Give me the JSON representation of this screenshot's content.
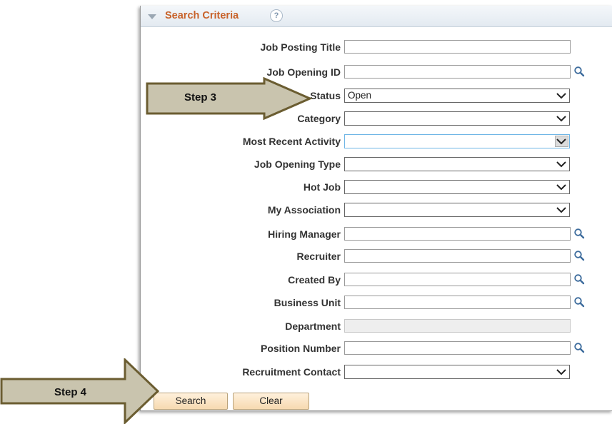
{
  "panel": {
    "title": "Search Criteria",
    "help_glyph": "?"
  },
  "fields": [
    {
      "label": "Job Posting Title",
      "kind": "input"
    },
    {
      "label": "Job Opening ID",
      "kind": "lookup"
    },
    {
      "label": "Status",
      "kind": "select",
      "value": "Open"
    },
    {
      "label": "Category",
      "kind": "select",
      "value": ""
    },
    {
      "label": "Most Recent Activity",
      "kind": "select",
      "value": ""
    },
    {
      "label": "Job Opening Type",
      "kind": "select",
      "value": ""
    },
    {
      "label": "Hot Job",
      "kind": "select",
      "value": ""
    },
    {
      "label": "My Association",
      "kind": "select",
      "value": ""
    },
    {
      "label": "Hiring Manager",
      "kind": "lookup"
    },
    {
      "label": "Recruiter",
      "kind": "lookup"
    },
    {
      "label": "Created By",
      "kind": "lookup"
    },
    {
      "label": "Business Unit",
      "kind": "lookup"
    },
    {
      "label": "Department",
      "kind": "disabled"
    },
    {
      "label": "Position Number",
      "kind": "lookup"
    },
    {
      "label": "Recruitment Contact",
      "kind": "select",
      "value": ""
    }
  ],
  "buttons": {
    "search": "Search",
    "clear": "Clear"
  },
  "callouts": {
    "step3": "Step 3",
    "step4": "Step 4"
  },
  "colors": {
    "accent": "#c8622a",
    "arrow_fill": "#c9c4ae",
    "arrow_stroke": "#6b5d31",
    "button_fill": "#f6d9b0"
  },
  "icons": {
    "lookup": "magnifier-icon",
    "dropdown": "chevron-down-icon",
    "collapse": "triangle-down-icon",
    "help": "help-icon"
  }
}
